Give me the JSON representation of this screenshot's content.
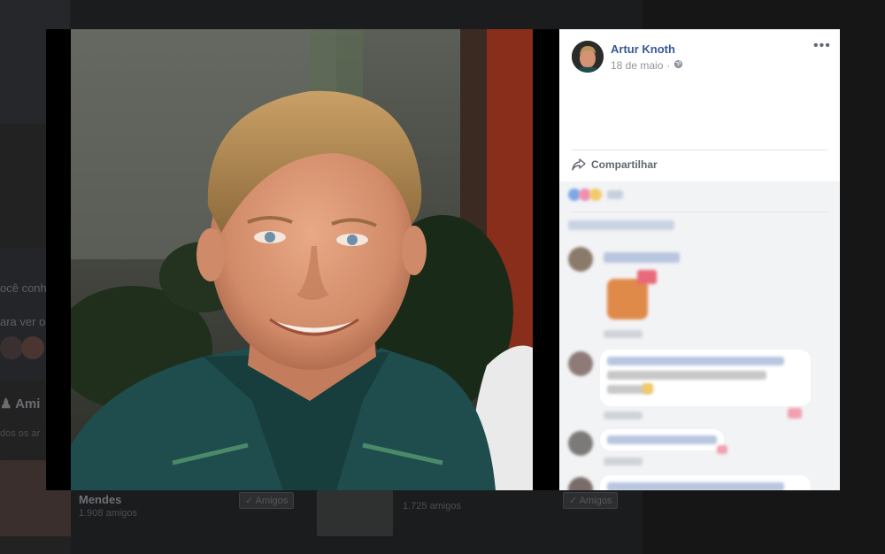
{
  "background": {
    "snippets": [
      {
        "id": "voce-conhe",
        "text": "ocê conhe"
      },
      {
        "id": "para-ver",
        "text": "ara ver o"
      },
      {
        "id": "amigos-heading",
        "text": "Ami"
      },
      {
        "id": "todos-os",
        "text": "dos os ar"
      }
    ],
    "friends": [
      {
        "name": "Mendes",
        "count": "1.908 amigos",
        "button": "Amigos"
      },
      {
        "name": "...",
        "count": "1.725 amigos",
        "button": "Amigos"
      }
    ]
  },
  "post": {
    "author": "Artur Knoth",
    "date": "18 de maio",
    "separator": "·",
    "share_label": "Compartilhar",
    "privacy_icon": "globe-icon",
    "more_icon": "more-options-icon"
  },
  "colors": {
    "author_link": "#365899",
    "meta_text": "#90949c",
    "comments_bg": "#f2f3f5",
    "overlay_bg": "#000000"
  }
}
